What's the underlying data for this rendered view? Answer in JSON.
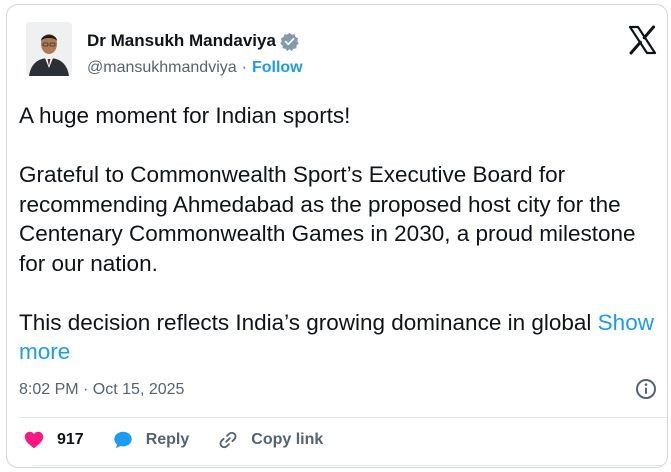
{
  "author": {
    "name": "Dr Mansukh Mandaviya",
    "handle": "@mansukhmandviya",
    "separator": "·",
    "follow_label": "Follow"
  },
  "tweet": {
    "paragraphs": [
      "A huge moment for Indian sports!",
      "Grateful to Commonwealth Sport’s Executive Board for recommending Ahmedabad as the proposed host city for the Centenary Commonwealth Games in 2030, a proud milestone for our nation."
    ],
    "last_paragraph": "This decision reflects India’s growing dominance in global",
    "show_more_label": "Show more",
    "timestamp": "8:02 PM · Oct 15, 2025"
  },
  "actions": {
    "like_count": "917",
    "reply_label": "Reply",
    "copy_link_label": "Copy link"
  },
  "colors": {
    "accent": "#1d9bf0",
    "like": "#f91880",
    "verified_badge": "#829aab",
    "secondary_text": "#536471"
  },
  "icons": [
    "verified-badge-icon",
    "x-logo-icon",
    "info-icon",
    "heart-icon",
    "reply-icon",
    "link-icon"
  ]
}
